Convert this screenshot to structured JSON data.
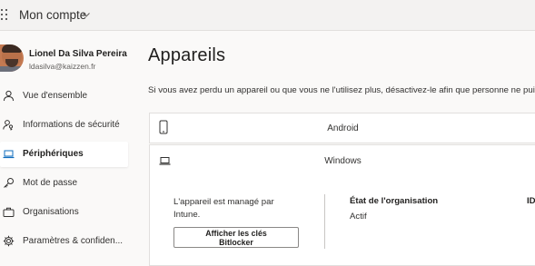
{
  "header": {
    "app_title": "Mon compte",
    "waffle_icon": "app-launcher-icon",
    "chevron_icon": "chevron-down-icon"
  },
  "user": {
    "name": "Lionel Da Silva Pereira",
    "email": "ldasilva@kaizzen.fr"
  },
  "sidebar": {
    "items": [
      {
        "label": "Vue d'ensemble",
        "icon": "person-icon",
        "active": false
      },
      {
        "label": "Informations de sécurité",
        "icon": "security-info-icon",
        "active": false
      },
      {
        "label": "Périphériques",
        "icon": "laptop-icon",
        "active": true
      },
      {
        "label": "Mot de passe",
        "icon": "key-icon",
        "active": false
      },
      {
        "label": "Organisations",
        "icon": "briefcase-icon",
        "active": false
      },
      {
        "label": "Paramètres & confiden...",
        "icon": "gear-icon",
        "active": false
      }
    ]
  },
  "main": {
    "title": "Appareils",
    "description": "Si vous avez perdu un appareil ou que vous ne l'utilisez plus, désactivez-le afin que personne ne puis",
    "devices": [
      {
        "name": "Android",
        "icon": "phone-icon"
      },
      {
        "name": "Windows",
        "icon": "laptop-icon",
        "expanded": true
      }
    ],
    "details": {
      "managed_text": "L'appareil est managé par Intune.",
      "org_state_label": "État de l'organisation",
      "org_state_value": "Actif",
      "id_label": "ID",
      "bitlocker_button_line1": "Afficher les clés",
      "bitlocker_button_line2": "Bitlocker"
    }
  },
  "colors": {
    "topbar_bg": "#f3f2f1",
    "page_bg": "#faf9f8",
    "card_bg": "#ffffff",
    "text_primary": "#201f1e"
  }
}
